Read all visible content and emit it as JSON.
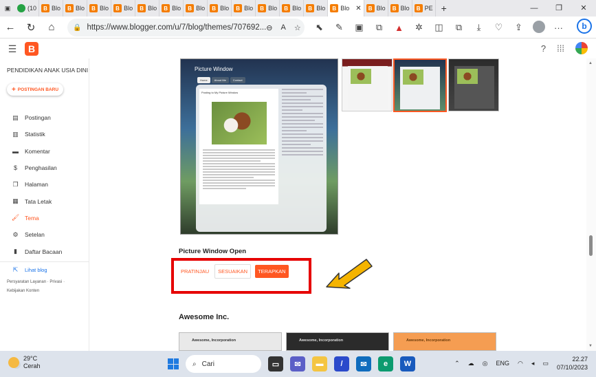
{
  "browser": {
    "tabs": [
      {
        "label": "(10",
        "type": "wa"
      },
      {
        "label": "Blo",
        "type": "blogger"
      },
      {
        "label": "Blo",
        "type": "blogger"
      },
      {
        "label": "Blo",
        "type": "blogger"
      },
      {
        "label": "Blo",
        "type": "blogger"
      },
      {
        "label": "Blo",
        "type": "blogger"
      },
      {
        "label": "Blo",
        "type": "blogger"
      },
      {
        "label": "Blo",
        "type": "blogger"
      },
      {
        "label": "Blo",
        "type": "blogger"
      },
      {
        "label": "Blo",
        "type": "blogger"
      },
      {
        "label": "Blo",
        "type": "blogger"
      },
      {
        "label": "Blo",
        "type": "blogger"
      },
      {
        "label": "Blo",
        "type": "blogger"
      },
      {
        "label": "Blo",
        "type": "blogger-active",
        "close": "✕"
      },
      {
        "label": "Blo",
        "type": "blogger"
      },
      {
        "label": "Blo",
        "type": "blogger"
      },
      {
        "label": "PE",
        "type": "blogger"
      }
    ],
    "new_tab": "+",
    "url": "https://www.blogger.com/u/7/blog/themes/707692..."
  },
  "blogger": {
    "blog_name": "PENDIDIKAN ANAK USIA DINI",
    "new_post": "POSTINGAN BARU",
    "menu": [
      {
        "label": "Postingan",
        "icon": "posts-icon",
        "glyph": "▤"
      },
      {
        "label": "Statistik",
        "icon": "stats-icon",
        "glyph": "▥"
      },
      {
        "label": "Komentar",
        "icon": "comment-icon",
        "glyph": "▬"
      },
      {
        "label": "Penghasilan",
        "icon": "dollar-icon",
        "glyph": "$"
      },
      {
        "label": "Halaman",
        "icon": "pages-icon",
        "glyph": "❐"
      },
      {
        "label": "Tata Letak",
        "icon": "layout-icon",
        "glyph": "▦"
      },
      {
        "label": "Tema",
        "icon": "theme-icon",
        "glyph": "🖌",
        "active": true
      },
      {
        "label": "Setelan",
        "icon": "settings-icon",
        "glyph": "⚙"
      },
      {
        "label": "Daftar Bacaan",
        "icon": "bookmark-icon",
        "glyph": "▮"
      }
    ],
    "view_blog": "Lihat blog",
    "footer_links": [
      "Persyaratan Layanan",
      "Privasi",
      "Kebijakan Konten"
    ],
    "preview": {
      "title": "Picture Window",
      "tabs": [
        "Home",
        "About Me",
        "Contact"
      ],
      "post_title": "Posting to My Picture Window"
    },
    "theme_name": "Picture Window Open",
    "buttons": {
      "preview": "PRATINJAU",
      "customize": "SESUAIKAN",
      "apply": "TERAPKAN"
    },
    "next_section": "Awesome Inc.",
    "next_thumb_label": "Awesome, Incorporation"
  },
  "taskbar": {
    "temp": "29°C",
    "weather": "Cerah",
    "search": "Cari",
    "lang": "ENG",
    "time": "22.27",
    "date": "07/10/2023"
  }
}
